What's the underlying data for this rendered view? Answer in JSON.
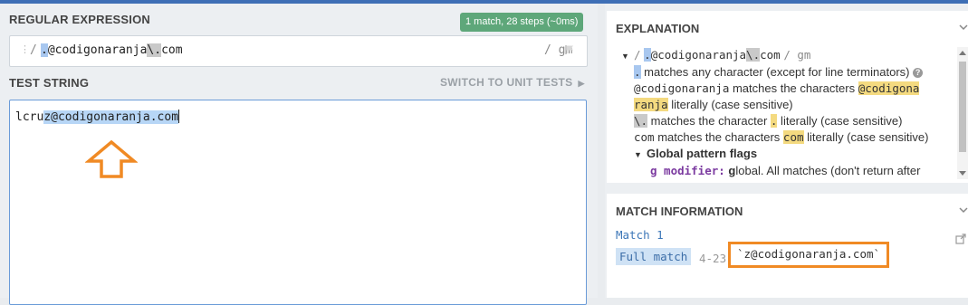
{
  "regex": {
    "section_title": "REGULAR EXPRESSION",
    "match_badge": "1 match, 28 steps (~0ms)",
    "delimiter_open": "/",
    "pattern_dot": ".",
    "pattern_literal": "@codigonaranja",
    "pattern_escape": "\\.",
    "pattern_tail": "com",
    "flags": "/ gm"
  },
  "test": {
    "section_title": "TEST STRING",
    "switch_label": "SWITCH TO UNIT TESTS",
    "text_before": "lcru",
    "text_match": "z@codigonaranja.com"
  },
  "explanation": {
    "title": "EXPLANATION",
    "summary_delim": "/",
    "summary_dot": ".",
    "summary_literal": "@codigonaranja",
    "summary_escape": "\\.",
    "summary_tail": "com",
    "summary_flags": "/ gm",
    "line1_token": ".",
    "line1_text": " matches any character (except for line terminators)",
    "line2_token": "@codigonaranja",
    "line2_text": " matches the characters ",
    "line2_hl_a": "@codigona",
    "line2_hl_b": "ranja",
    "line2_tail": " literally (case sensitive)",
    "line3_token": "\\.",
    "line3_text": " matches the character ",
    "line3_hl": ".",
    "line3_tail": " literally (case sensitive)",
    "line4_token": "com",
    "line4_text": " matches the characters ",
    "line4_hl": "com",
    "line4_tail": " literally (case sensitive)",
    "flags_heading": "Global pattern flags",
    "flag_g_code": "g modifier:",
    "flag_g_letter": "g",
    "flag_g_text": "lobal. All matches (don't return after"
  },
  "match_info": {
    "title": "MATCH INFORMATION",
    "match_label": "Match 1",
    "full_match_label": "Full match",
    "range": "4-23",
    "value": "`z@codigonaranja.com`"
  },
  "colors": {
    "accent": "#3e6fb6",
    "badge_green": "#5ea77a",
    "highlight_orange": "#f08a24"
  }
}
